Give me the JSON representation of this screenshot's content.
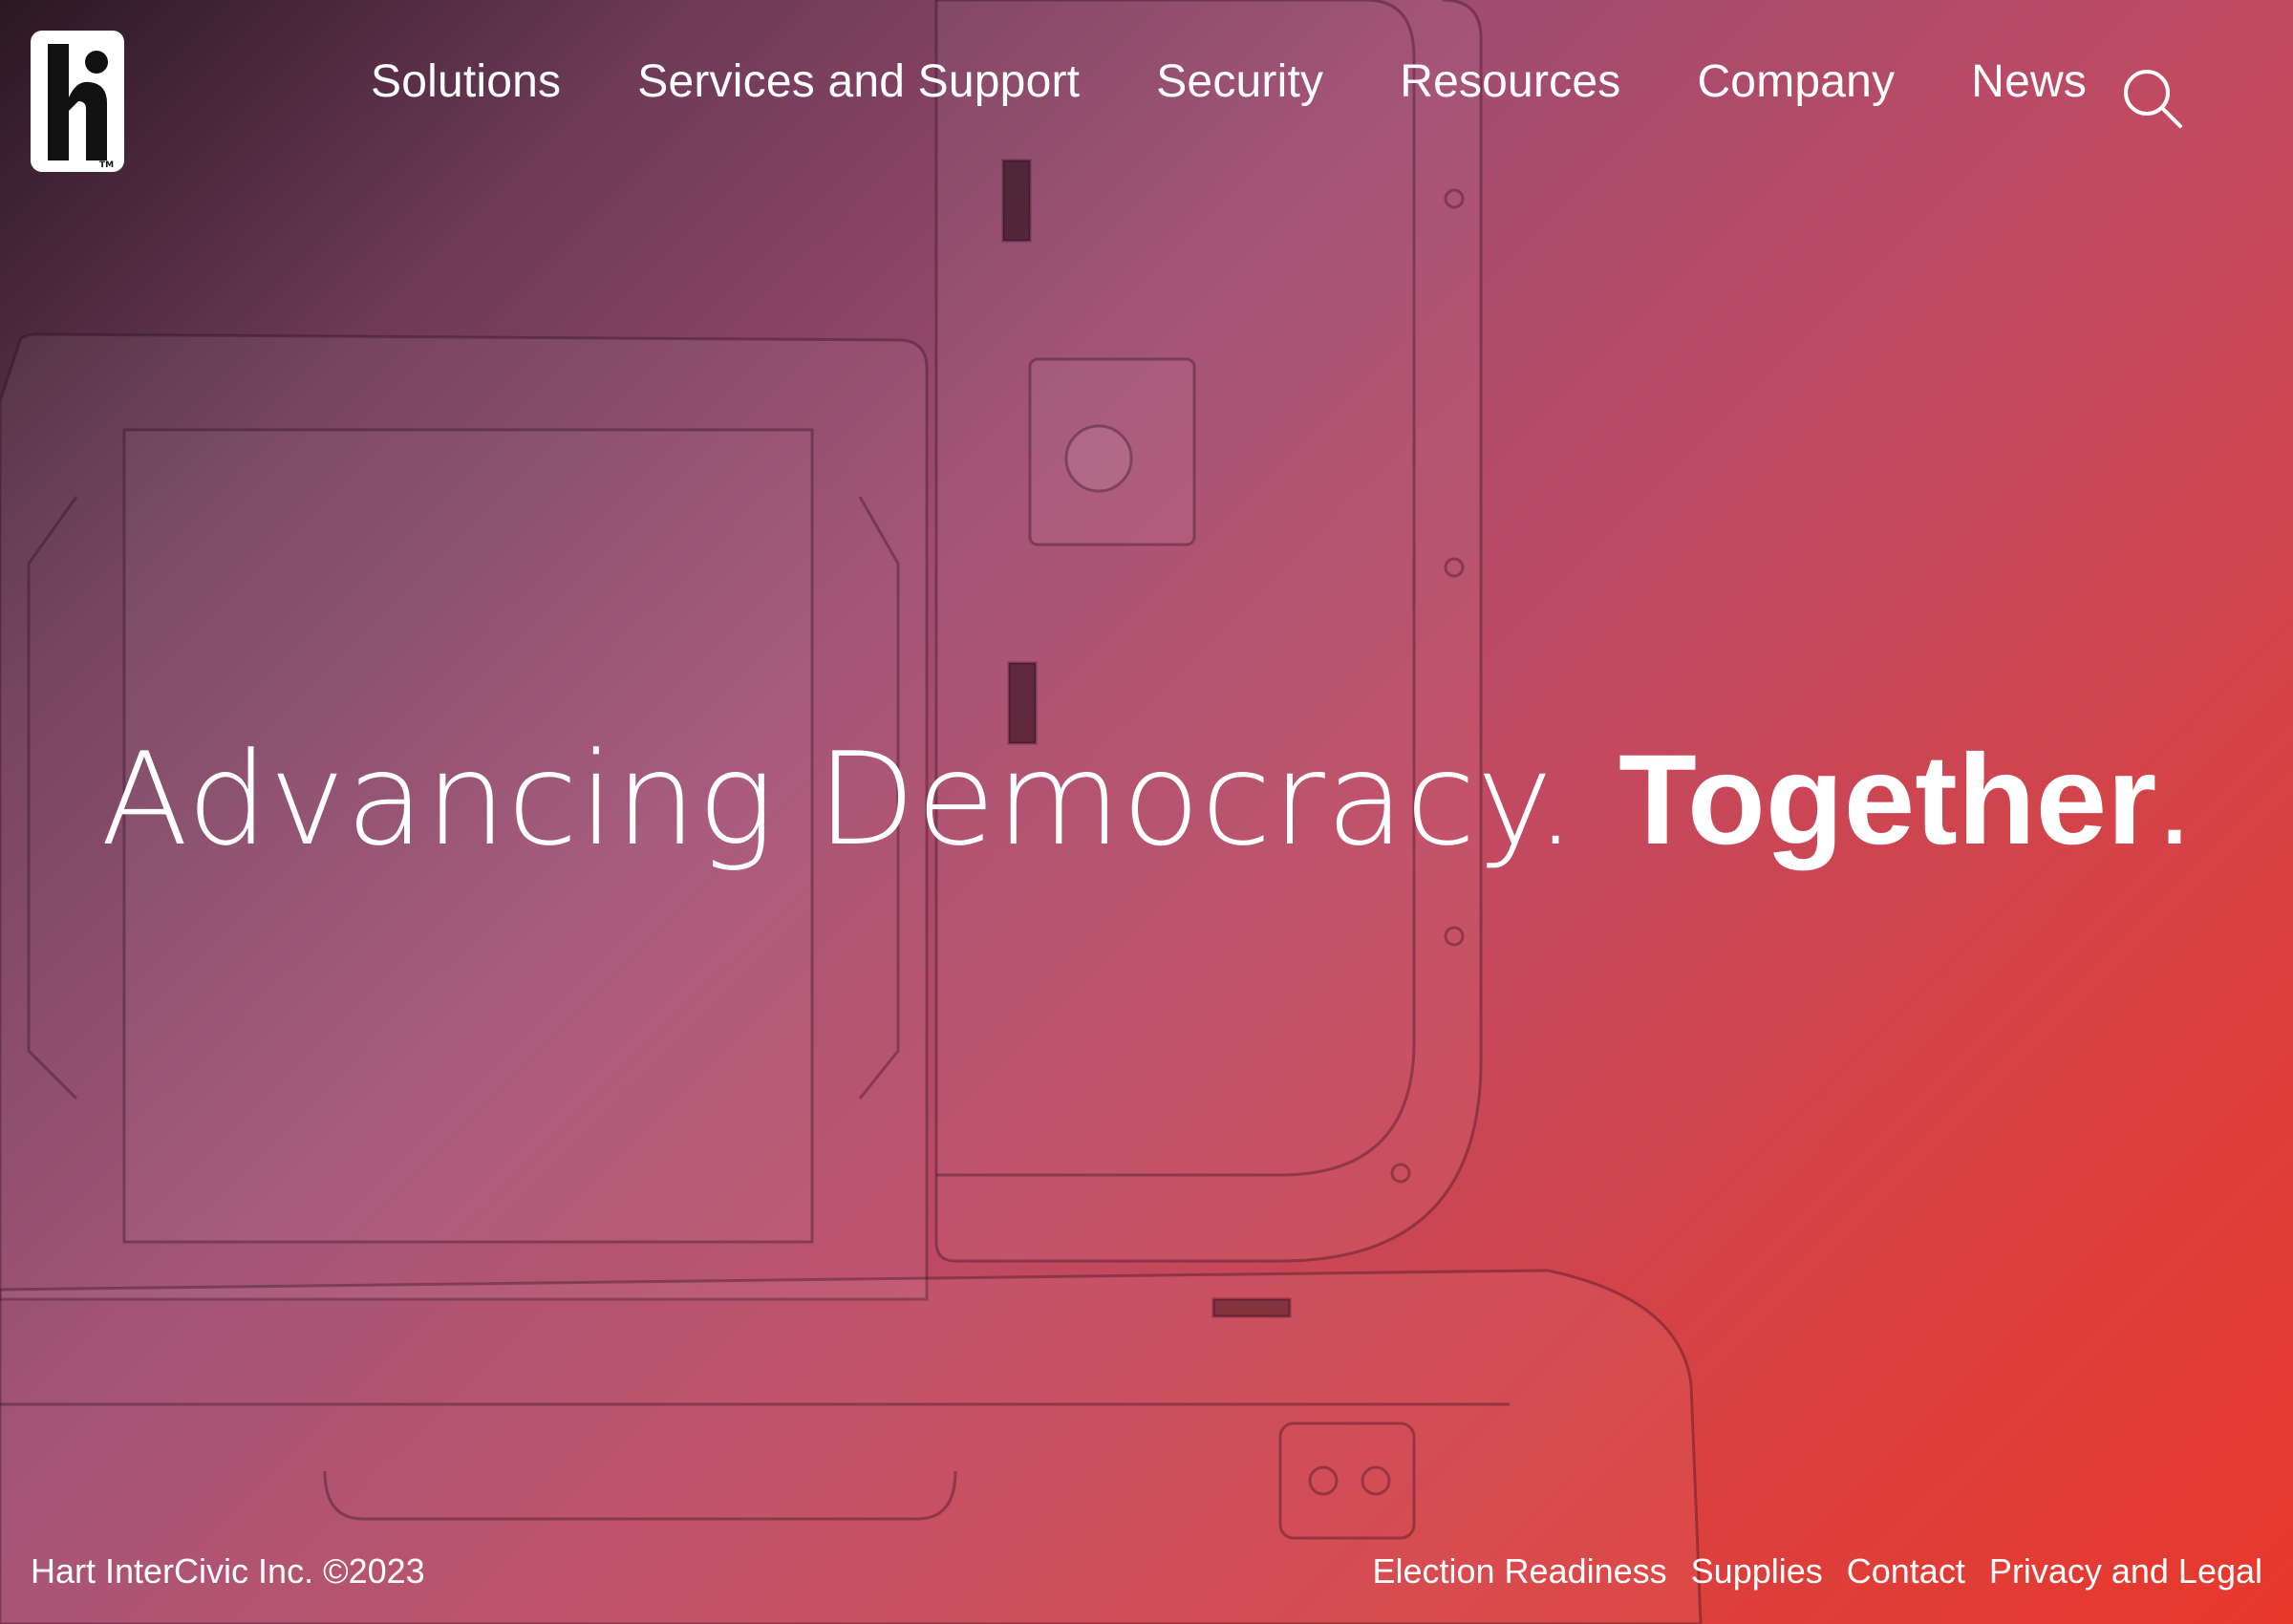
{
  "brand": {
    "logo_alt": "hi",
    "trademark": "TM"
  },
  "nav": {
    "items": [
      {
        "label": "Solutions"
      },
      {
        "label": "Services and Support"
      },
      {
        "label": "Security"
      },
      {
        "label": "Resources"
      },
      {
        "label": "Company"
      },
      {
        "label": "News"
      }
    ],
    "search_icon": "search-icon"
  },
  "hero": {
    "light_text": "Advancing Democracy. ",
    "bold_text": "Together",
    "end_punct": "."
  },
  "footer": {
    "copyright": "Hart InterCivic Inc. ©2023",
    "links": [
      {
        "label": "Election Readiness"
      },
      {
        "label": "Supplies"
      },
      {
        "label": "Contact"
      },
      {
        "label": "Privacy and Legal"
      }
    ]
  },
  "colors": {
    "gradient_dark": "#2a1822",
    "gradient_mid": "#c04a62",
    "gradient_red": "#e8382c",
    "text": "#ffffff"
  }
}
